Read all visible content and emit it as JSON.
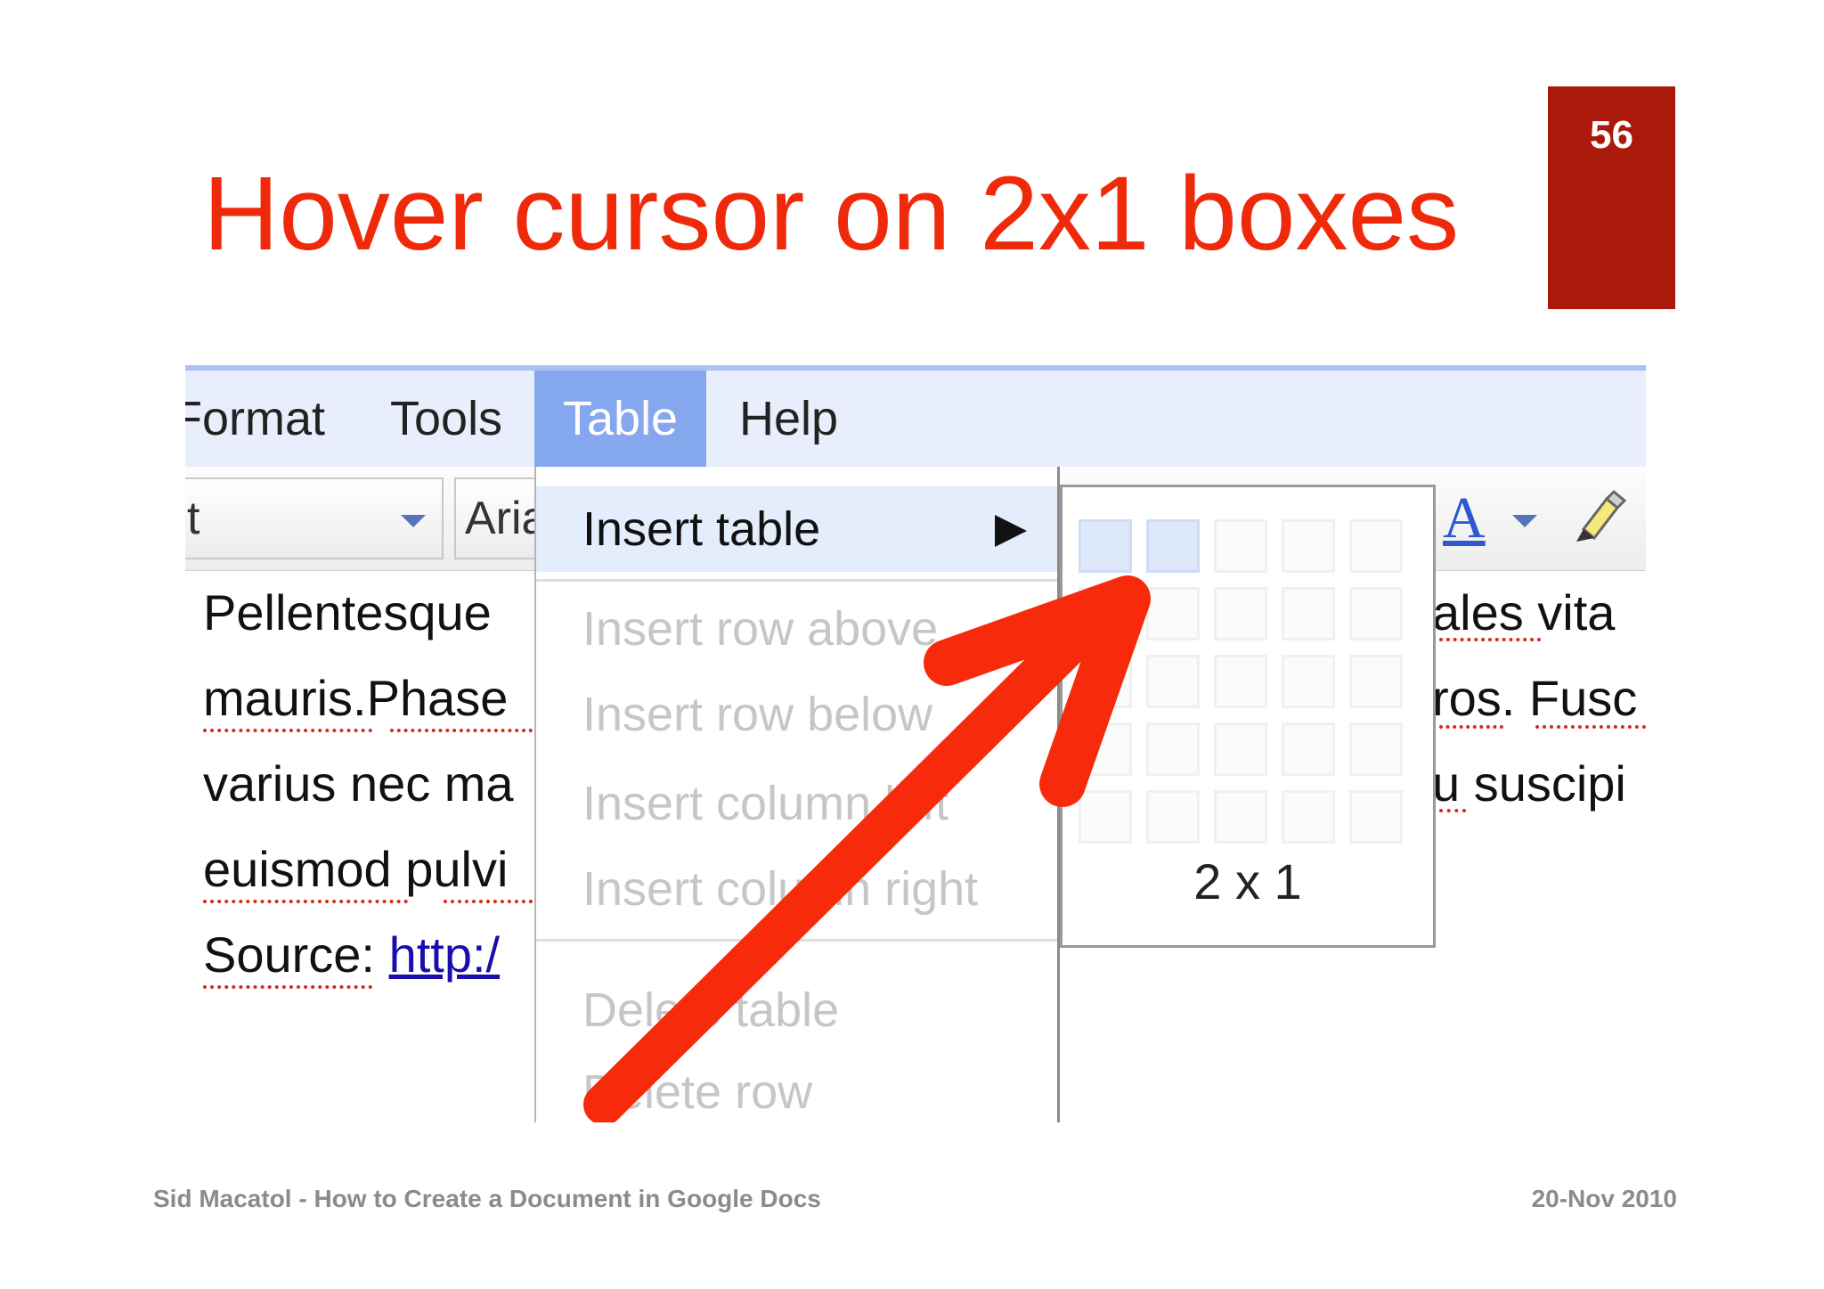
{
  "slide": {
    "number": "56",
    "title": "Hover cursor on 2x1 boxes",
    "footer_left": "Sid Macatol - How to Create a Document in Google Docs",
    "footer_right": "20-Nov 2010",
    "accent_color": "#ee2a0b",
    "badge_color": "#ab190b"
  },
  "menubar": {
    "items": [
      "Format",
      "Tools",
      "Table",
      "Help"
    ],
    "active": "Table"
  },
  "toolbar": {
    "style_select": "t",
    "font_select": "Aria",
    "font_color_label": "A",
    "icons": [
      "chevron-down-icon",
      "text-color-icon",
      "highlighter-icon"
    ]
  },
  "document": {
    "left_lines": [
      "Pellentesque",
      "mauris.Phase",
      "varius nec ma",
      "euismod pulvi"
    ],
    "source_label": "Source:",
    "source_link": "http:/",
    "right_lines": [
      "ales vita",
      "ros. Fusc",
      "u suscipi"
    ]
  },
  "table_menu": {
    "items": [
      {
        "label": "Insert table",
        "state": "hover"
      },
      {
        "label": "Insert row above",
        "state": "disabled"
      },
      {
        "label": "Insert row below",
        "state": "disabled"
      },
      {
        "label": "Insert column left",
        "state": "disabled"
      },
      {
        "label": "Insert column right",
        "state": "disabled"
      },
      {
        "label": "Delete table",
        "state": "disabled"
      },
      {
        "label": "Delete row",
        "state": "disabled"
      }
    ]
  },
  "table_picker": {
    "rows": 5,
    "cols": 5,
    "selected_cols": 2,
    "selected_rows": 1,
    "size_label": "2 x 1"
  },
  "annotation": {
    "arrow_color": "#f72a0b"
  }
}
